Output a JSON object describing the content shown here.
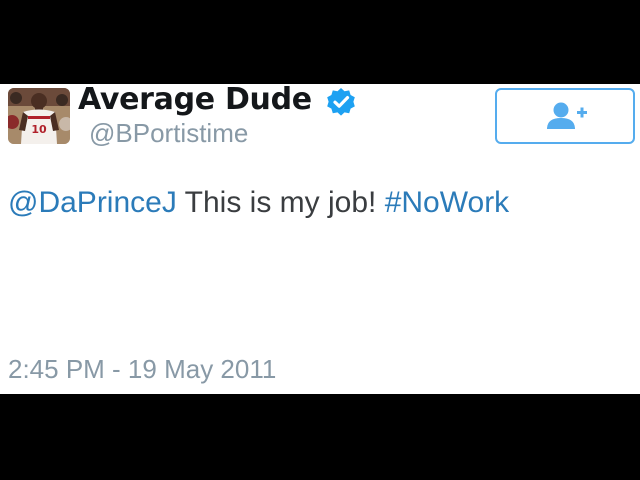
{
  "tweet": {
    "display_name": "Average Dude",
    "handle": "@BPortistime",
    "verified": true,
    "mention": "@DaPrinceJ",
    "body_text": "This is my job!",
    "hashtag": "#NoWork",
    "timestamp": "2:45 PM - 19 May 2011",
    "avatar_jersey_number": "10"
  },
  "follow_button": {
    "icon": "follow-user-icon"
  },
  "colors": {
    "link": "#2b7bb9",
    "accent": "#55acee",
    "verified": "#1da1f2",
    "muted_text": "#8899a6",
    "name_text": "#14171a",
    "frame": "#000000"
  }
}
